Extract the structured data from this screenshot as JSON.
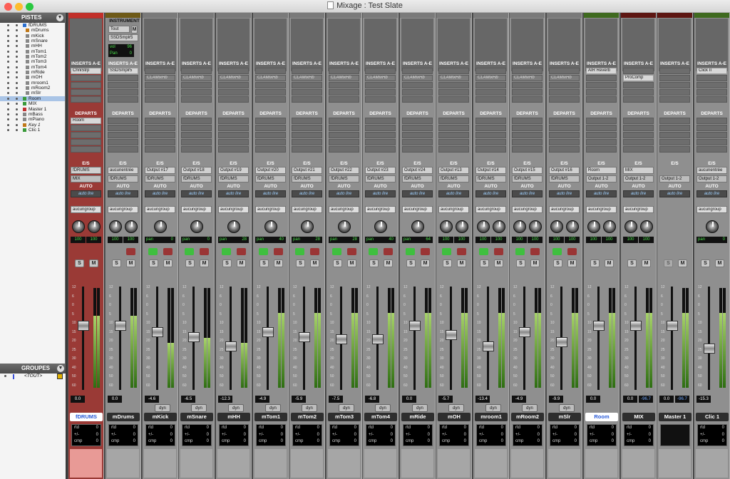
{
  "window": {
    "title": "Mixage : Test Slate"
  },
  "colors": {
    "red": "#c2302a",
    "olive": "#6e5a18",
    "green": "#3f6a1f",
    "darkred": "#5d1612",
    "drums_bg": "#9a3a36",
    "selected_name": "#ffffff"
  },
  "tracks_panel": {
    "header": "PISTES",
    "items": [
      {
        "name": "fDRUMS",
        "icon": "folder",
        "indent": 0
      },
      {
        "name": "mDrums",
        "icon": "instrument",
        "indent": 1
      },
      {
        "name": "mKick",
        "icon": "audio",
        "indent": 1
      },
      {
        "name": "mSnare",
        "icon": "audio",
        "indent": 1
      },
      {
        "name": "mHH",
        "icon": "audio",
        "indent": 1
      },
      {
        "name": "mTom1",
        "icon": "audio",
        "indent": 1
      },
      {
        "name": "mTom2",
        "icon": "audio",
        "indent": 1
      },
      {
        "name": "mTom3",
        "icon": "audio",
        "indent": 1
      },
      {
        "name": "mTom4",
        "icon": "audio",
        "indent": 1
      },
      {
        "name": "mRide",
        "icon": "audio",
        "indent": 1
      },
      {
        "name": "mOH",
        "icon": "audio",
        "indent": 1
      },
      {
        "name": "mroom1",
        "icon": "audio",
        "indent": 1
      },
      {
        "name": "mRoom2",
        "icon": "audio",
        "indent": 1
      },
      {
        "name": "mSlr",
        "icon": "audio",
        "indent": 1
      },
      {
        "name": "Room",
        "icon": "aux",
        "indent": 0
      },
      {
        "name": "MIX",
        "icon": "aux",
        "indent": 0
      },
      {
        "name": "Master 1",
        "icon": "master",
        "indent": 0
      },
      {
        "name": "mBass",
        "icon": "audio",
        "indent": 0
      },
      {
        "name": "mPiano",
        "icon": "audio",
        "indent": 0
      },
      {
        "name": "Key 1",
        "icon": "instrument",
        "indent": 0
      },
      {
        "name": "Clic 1",
        "icon": "aux",
        "indent": 0
      }
    ]
  },
  "groups_panel": {
    "header": "GROUPES",
    "items": [
      {
        "name": "<TOUT>"
      }
    ]
  },
  "labels": {
    "inserts": "INSERTS A-E",
    "departs": "DEPARTS",
    "es": "E/S",
    "auto": "AUTO",
    "instrument": "INSTRUMENT",
    "tout": "Tout",
    "m": "M",
    "vol": "vol",
    "vol_val": "96",
    "pan": "Pan",
    "pan_val": "0",
    "rtd": "rtd",
    "pm": "+/-",
    "cmp": "cmp",
    "zero": "0",
    "s": "S",
    "mbtn": "M"
  },
  "strips": [
    {
      "name": "fDRUMS",
      "color": "red",
      "inserts": [
        "ChnlStrp"
      ],
      "sends": [
        "Room"
      ],
      "io_in": "fDRUMS",
      "io_out": "MIX",
      "auto": "auto lire",
      "group": "aucungroup",
      "pan_type": "stereo",
      "pan_l": "100",
      "pan_r": "100",
      "volume": "0.0",
      "level": 0.72,
      "fader": 0.62,
      "mode": "",
      "name_selected": true
    },
    {
      "name": "mDrums",
      "color": "olive",
      "inserts": [
        "SSDSmplr5"
      ],
      "sends": [],
      "io_in": "aucunentrée",
      "io_out": "fDRUMS",
      "auto": "auto lire",
      "group": "aucungroup",
      "pan_type": "stereo",
      "pan_l": "100",
      "pan_r": "100",
      "volume": "0.0",
      "level": 0.72,
      "fader": 0.62,
      "mode": "",
      "name_selected": false
    },
    {
      "name": "mKick",
      "color": "none",
      "inserts": [
        "",
        "CLAMixHb"
      ],
      "sends": [],
      "io_in": "Output #17",
      "io_out": "fDRUMS",
      "auto": "auto lire",
      "group": "aucungroup",
      "pan_type": "mono",
      "pan_val": "0",
      "volume": "-4.6",
      "level": 0.45,
      "fader": 0.55,
      "mode": "dyn",
      "name_selected": false
    },
    {
      "name": "mSnare",
      "color": "none",
      "inserts": [
        "",
        "CLAMixHb"
      ],
      "sends": [],
      "io_in": "Output #18",
      "io_out": "fDRUMS",
      "auto": "auto lire",
      "group": "aucungroup",
      "pan_type": "mono",
      "pan_val": "0",
      "volume": "-6.5",
      "level": 0.5,
      "fader": 0.5,
      "mode": "dyn",
      "name_selected": false
    },
    {
      "name": "mHH",
      "color": "none",
      "inserts": [
        "",
        "CLAMixHb"
      ],
      "sends": [],
      "io_in": "Output #19",
      "io_out": "fDRUMS",
      "auto": "auto lire",
      "group": "aucungroup",
      "pan_type": "mono",
      "pan_val": "28",
      "volume": "-12.3",
      "level": 0.45,
      "fader": 0.4,
      "mode": "dyn",
      "name_selected": false
    },
    {
      "name": "mTom1",
      "color": "none",
      "inserts": [
        "",
        "CLAMixHb"
      ],
      "sends": [],
      "io_in": "Output #20",
      "io_out": "fDRUMS",
      "auto": "auto lire",
      "group": "aucungroup",
      "pan_type": "mono",
      "pan_val": "40",
      "volume": "-4.9",
      "level": 0.75,
      "fader": 0.55,
      "mode": "dyn",
      "name_selected": false
    },
    {
      "name": "mTom2",
      "color": "none",
      "inserts": [
        "",
        "CLAMixHb"
      ],
      "sends": [],
      "io_in": "Output #21",
      "io_out": "fDRUMS",
      "auto": "auto lire",
      "group": "aucungroup",
      "pan_type": "mono",
      "pan_val": "28",
      "volume": "-5.9",
      "level": 0.75,
      "fader": 0.5,
      "mode": "dyn",
      "name_selected": false
    },
    {
      "name": "mTom3",
      "color": "none",
      "inserts": [
        "",
        "CLAMixHb"
      ],
      "sends": [],
      "io_in": "Output #22",
      "io_out": "fDRUMS",
      "auto": "auto lire",
      "group": "aucungroup",
      "pan_type": "mono",
      "pan_val": "28",
      "volume": "-7.5",
      "level": 0.75,
      "fader": 0.48,
      "mode": "dyn",
      "name_selected": false
    },
    {
      "name": "mTom4",
      "color": "none",
      "inserts": [
        "",
        "CLAMixHb"
      ],
      "sends": [],
      "io_in": "Output #23",
      "io_out": "fDRUMS",
      "auto": "auto lire",
      "group": "aucungroup",
      "pan_type": "mono",
      "pan_val": "40",
      "volume": "-6.8",
      "level": 0.75,
      "fader": 0.48,
      "mode": "dyn",
      "name_selected": false
    },
    {
      "name": "mRide",
      "color": "none",
      "inserts": [
        "",
        "CLAMixHb"
      ],
      "sends": [],
      "io_in": "Output #24",
      "io_out": "fDRUMS",
      "auto": "auto lire",
      "group": "aucungroup",
      "pan_type": "mono",
      "pan_val": "64",
      "volume": "0.0",
      "level": 0.75,
      "fader": 0.62,
      "mode": "dyn",
      "name_selected": false
    },
    {
      "name": "mOH",
      "color": "none",
      "inserts": [
        "",
        "CLAMixHb"
      ],
      "sends": [],
      "io_in": "Output #13",
      "io_out": "fDRUMS",
      "auto": "auto lire",
      "group": "aucungroup",
      "pan_type": "stereo",
      "pan_l": "100",
      "pan_r": "100",
      "volume": "-5.7",
      "level": 0.75,
      "fader": 0.52,
      "mode": "dyn",
      "name_selected": false
    },
    {
      "name": "mroom1",
      "color": "none",
      "inserts": [
        "",
        "CLAMixHb"
      ],
      "sends": [],
      "io_in": "Output #14",
      "io_out": "fDRUMS",
      "auto": "auto lire",
      "group": "aucungroup",
      "pan_type": "stereo",
      "pan_l": "100",
      "pan_r": "100",
      "volume": "-13.4",
      "level": 0.75,
      "fader": 0.4,
      "mode": "dyn",
      "name_selected": false
    },
    {
      "name": "mRoom2",
      "color": "none",
      "inserts": [
        "",
        "CLAMixHb"
      ],
      "sends": [],
      "io_in": "Output #15",
      "io_out": "fDRUMS",
      "auto": "auto lire",
      "group": "aucungroup",
      "pan_type": "stereo",
      "pan_l": "100",
      "pan_r": "100",
      "volume": "-4.9",
      "level": 0.75,
      "fader": 0.55,
      "mode": "dyn",
      "name_selected": false
    },
    {
      "name": "mSlr",
      "color": "none",
      "inserts": [
        "",
        "CLAMixHb"
      ],
      "sends": [],
      "io_in": "Output #16",
      "io_out": "fDRUMS",
      "auto": "auto lire",
      "group": "aucungroup",
      "pan_type": "stereo",
      "pan_l": "100",
      "pan_r": "100",
      "volume": "-9.9",
      "level": 0.75,
      "fader": 0.45,
      "mode": "dyn",
      "name_selected": false
    },
    {
      "name": "Room",
      "color": "green",
      "inserts": [
        "AIR Reverb"
      ],
      "sends": [],
      "io_in": "Room",
      "io_out": "Output 1-2",
      "auto": "auto lire",
      "group": "aucungroup",
      "pan_type": "stereo",
      "pan_l": "100",
      "pan_r": "100",
      "volume": "0.0",
      "level": 0.75,
      "fader": 0.62,
      "mode": "",
      "name_selected": true
    },
    {
      "name": "MIX",
      "color": "darkred",
      "inserts": [
        "",
        "ProComp"
      ],
      "sends": [],
      "io_in": "MIX",
      "io_out": "Output 1-2",
      "auto": "auto lire",
      "group": "aucungroup",
      "pan_type": "stereo",
      "pan_l": "100",
      "pan_r": "100",
      "volume": "0.0",
      "extra_val": "-96.7",
      "level": 0.75,
      "fader": 0.62,
      "mode": "",
      "name_selected": false
    },
    {
      "name": "Master 1",
      "color": "darkred",
      "inserts": [],
      "sends": [],
      "io_in": "",
      "io_out": "Output 1-2",
      "auto": "auto lire",
      "group": "",
      "pan_type": "none",
      "volume": "0.0",
      "extra_val": "-96.7",
      "level": 0.75,
      "fader": 0.62,
      "mode": "",
      "name_selected": false
    },
    {
      "name": "Clic 1",
      "color": "green",
      "inserts": [
        "Click II"
      ],
      "sends": [],
      "io_in": "aucunentrée",
      "io_out": "Output 1-2",
      "auto": "auto lire",
      "group": "aucungroup",
      "pan_type": "mono",
      "pan_val": "0",
      "volume": "-15.3",
      "level": 0.75,
      "fader": 0.38,
      "mode": "",
      "name_selected": false
    }
  ],
  "scale_labels": [
    "12",
    "6",
    "0",
    "5",
    "10",
    "15",
    "20",
    "25",
    "30",
    "40",
    "50",
    "60"
  ]
}
